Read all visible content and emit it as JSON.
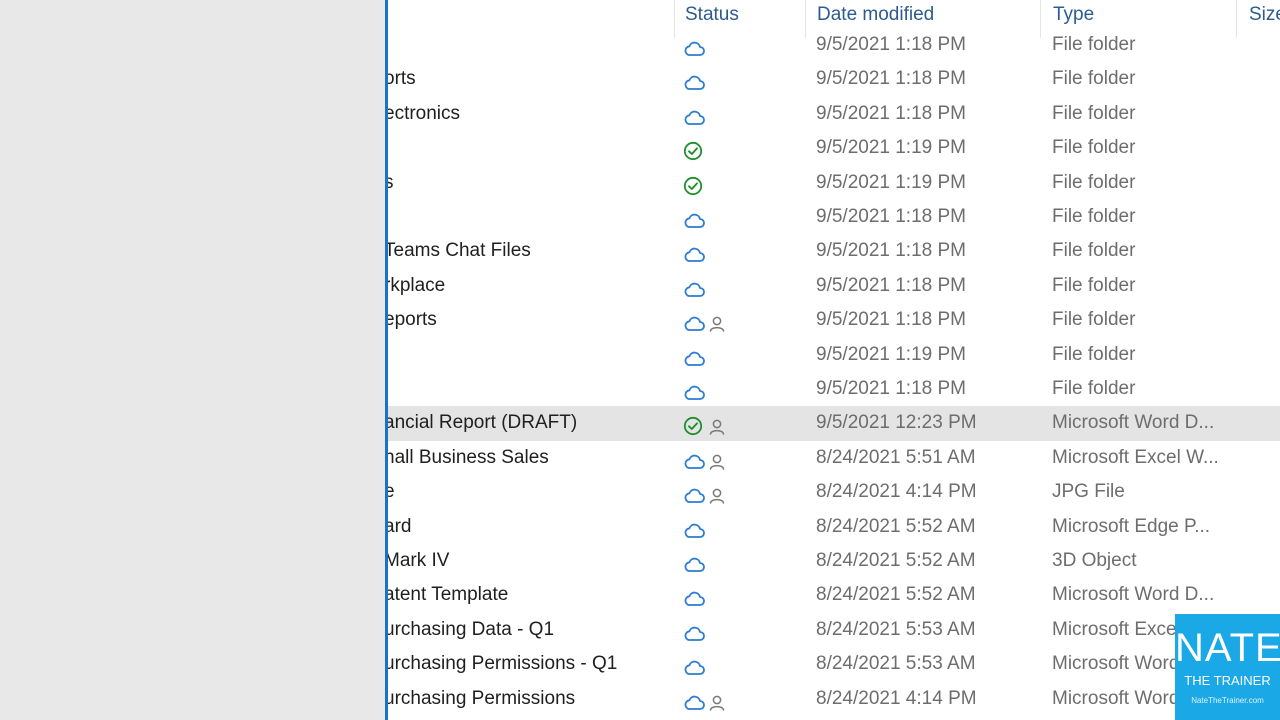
{
  "header": {
    "status": "Status",
    "date_modified": "Date modified",
    "type": "Type",
    "size": "Size"
  },
  "colors": {
    "cloud": "#2b7cd3",
    "synced_check": "#1f8f2c",
    "shared_person": "#7a7a7a",
    "accent_divider": "#1a73c8",
    "watermark_bg": "#1aa8e6"
  },
  "rows": [
    {
      "name": "",
      "status": [
        "cloud-icon"
      ],
      "date": "9/5/2021 1:18 PM",
      "type": "File folder"
    },
    {
      "name": "orts",
      "status": [
        "cloud-icon"
      ],
      "date": "9/5/2021 1:18 PM",
      "type": "File folder"
    },
    {
      "name": "ectronics",
      "status": [
        "cloud-icon"
      ],
      "date": "9/5/2021 1:18 PM",
      "type": "File folder"
    },
    {
      "name": "",
      "status": [
        "check-icon"
      ],
      "date": "9/5/2021 1:19 PM",
      "type": "File folder"
    },
    {
      "name": "s",
      "status": [
        "check-icon"
      ],
      "date": "9/5/2021 1:19 PM",
      "type": "File folder"
    },
    {
      "name": "",
      "status": [
        "cloud-icon"
      ],
      "date": "9/5/2021 1:18 PM",
      "type": "File folder"
    },
    {
      "name": "Teams Chat Files",
      "status": [
        "cloud-icon"
      ],
      "date": "9/5/2021 1:18 PM",
      "type": "File folder"
    },
    {
      "name": "rkplace",
      "status": [
        "cloud-icon"
      ],
      "date": "9/5/2021 1:18 PM",
      "type": "File folder"
    },
    {
      "name": "eports",
      "status": [
        "cloud-icon",
        "person-icon"
      ],
      "date": "9/5/2021 1:18 PM",
      "type": "File folder"
    },
    {
      "name": "",
      "status": [
        "cloud-icon"
      ],
      "date": "9/5/2021 1:19 PM",
      "type": "File folder"
    },
    {
      "name": "",
      "status": [
        "cloud-icon"
      ],
      "date": "9/5/2021 1:18 PM",
      "type": "File folder"
    },
    {
      "name": "ancial Report (DRAFT)",
      "status": [
        "check-icon",
        "person-icon"
      ],
      "date": "9/5/2021 12:23 PM",
      "type": "Microsoft Word D...",
      "selected": true
    },
    {
      "name": "nall Business Sales",
      "status": [
        "cloud-icon",
        "person-icon"
      ],
      "date": "8/24/2021 5:51 AM",
      "type": "Microsoft Excel W..."
    },
    {
      "name": "e",
      "status": [
        "cloud-icon",
        "person-icon"
      ],
      "date": "8/24/2021 4:14 PM",
      "type": "JPG File"
    },
    {
      "name": "ard",
      "status": [
        "cloud-icon"
      ],
      "date": "8/24/2021 5:52 AM",
      "type": "Microsoft Edge P..."
    },
    {
      "name": "Mark IV",
      "status": [
        "cloud-icon"
      ],
      "date": "8/24/2021 5:52 AM",
      "type": "3D Object"
    },
    {
      "name": "atent Template",
      "status": [
        "cloud-icon"
      ],
      "date": "8/24/2021 5:52 AM",
      "type": "Microsoft Word D..."
    },
    {
      "name": "urchasing Data - Q1",
      "status": [
        "cloud-icon"
      ],
      "date": "8/24/2021 5:53 AM",
      "type": "Microsoft Excel W..."
    },
    {
      "name": "urchasing Permissions - Q1",
      "status": [
        "cloud-icon"
      ],
      "date": "8/24/2021 5:53 AM",
      "type": "Microsoft Word D..."
    },
    {
      "name": "urchasing Permissions",
      "status": [
        "cloud-icon",
        "person-icon"
      ],
      "date": "8/24/2021 4:14 PM",
      "type": "Microsoft Word D..."
    }
  ],
  "watermark": {
    "name": "NATE",
    "subtitle": "THE TRAINER",
    "url": "NateTheTrainer.com"
  }
}
